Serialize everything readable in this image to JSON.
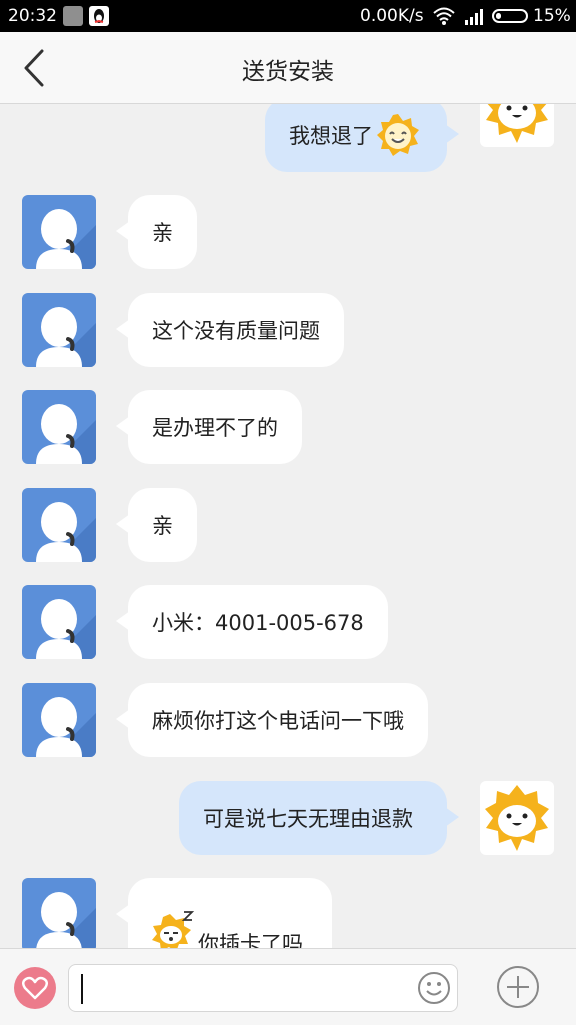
{
  "status_bar": {
    "time": "20:32",
    "network_speed": "0.00K/s",
    "battery_percent": "15%",
    "icons": [
      "app-notification-icon",
      "qq-icon",
      "wifi-icon",
      "signal-icon",
      "battery-icon"
    ]
  },
  "header": {
    "title": "送货安装",
    "back_icon": "back-arrow-icon"
  },
  "messages": [
    {
      "sender": "user",
      "text": "我想退了",
      "sticker": "smiling-sun-sticker"
    },
    {
      "sender": "agent",
      "text": "亲"
    },
    {
      "sender": "agent",
      "text": "这个没有质量问题"
    },
    {
      "sender": "agent",
      "text": "是办理不了的"
    },
    {
      "sender": "agent",
      "text": "亲"
    },
    {
      "sender": "agent",
      "text": "小米：4001-005-678"
    },
    {
      "sender": "agent",
      "text": "麻烦你打这个电话问一下哦"
    },
    {
      "sender": "user",
      "text": "可是说七天无理由退款"
    },
    {
      "sender": "agent",
      "text": "你插卡了吗",
      "sticker": "sleepy-lion-sticker"
    }
  ],
  "input": {
    "value": "",
    "icons": [
      "heart-icon",
      "emoji-icon",
      "plus-icon"
    ]
  },
  "colors": {
    "agent_avatar": "#5b8fd9",
    "user_bubble": "#d5e6fb",
    "agent_bubble": "#ffffff",
    "sticker_yellow": "#f5b21c",
    "heart_button": "#ec7b8b"
  }
}
